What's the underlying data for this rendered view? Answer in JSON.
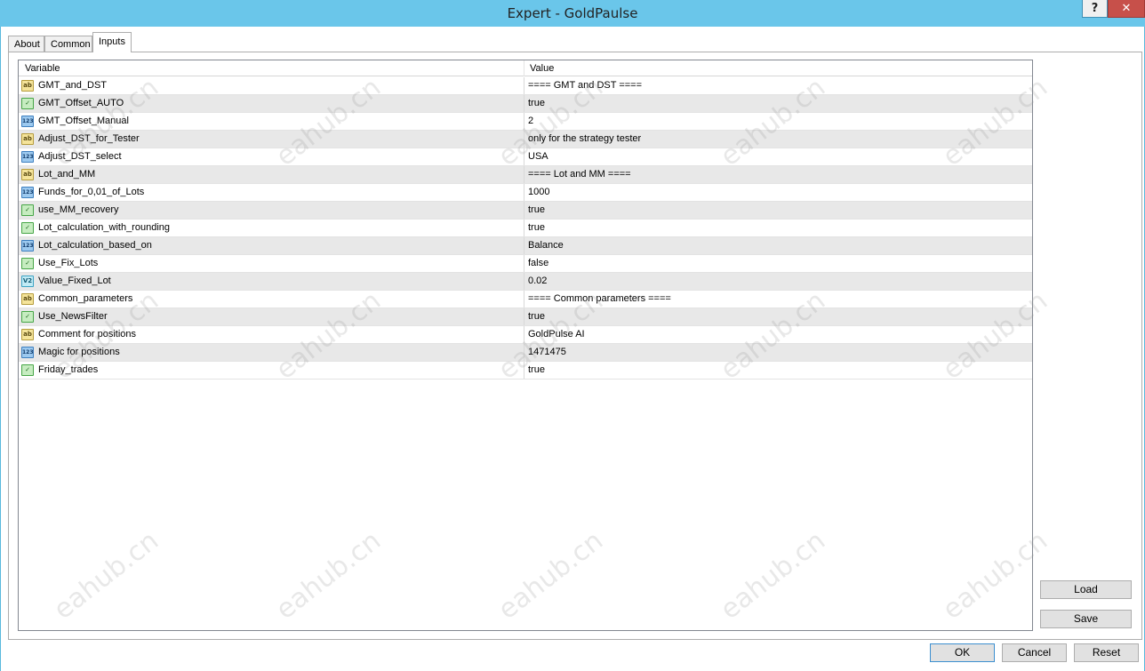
{
  "window": {
    "title": "Expert - GoldPaulse",
    "help_label": "?",
    "close_label": "✕"
  },
  "tabs": [
    {
      "label": "About"
    },
    {
      "label": "Common"
    },
    {
      "label": "Inputs"
    }
  ],
  "active_tab": "Inputs",
  "table": {
    "headers": {
      "variable": "Variable",
      "value": "Value"
    },
    "rows": [
      {
        "icon": "ab",
        "variable": "GMT_and_DST",
        "value": "==== GMT and DST ===="
      },
      {
        "icon": "bool",
        "variable": "GMT_Offset_AUTO",
        "value": "true"
      },
      {
        "icon": "123",
        "variable": "GMT_Offset_Manual",
        "value": "2"
      },
      {
        "icon": "ab",
        "variable": "Adjust_DST_for_Tester",
        "value": "only for the strategy tester"
      },
      {
        "icon": "123",
        "variable": "Adjust_DST_select",
        "value": "USA"
      },
      {
        "icon": "ab",
        "variable": "Lot_and_MM",
        "value": "==== Lot and MM ===="
      },
      {
        "icon": "123",
        "variable": "Funds_for_0,01_of_Lots",
        "value": "1000"
      },
      {
        "icon": "bool",
        "variable": "use_MM_recovery",
        "value": "true"
      },
      {
        "icon": "bool",
        "variable": "Lot_calculation_with_rounding",
        "value": "true"
      },
      {
        "icon": "123",
        "variable": "Lot_calculation_based_on",
        "value": "Balance"
      },
      {
        "icon": "bool",
        "variable": "Use_Fix_Lots",
        "value": "false"
      },
      {
        "icon": "dbl",
        "variable": "Value_Fixed_Lot",
        "value": "0.02"
      },
      {
        "icon": "ab",
        "variable": "Common_parameters",
        "value": "==== Common parameters ===="
      },
      {
        "icon": "bool",
        "variable": "Use_NewsFilter",
        "value": "true"
      },
      {
        "icon": "ab",
        "variable": "Comment for positions",
        "value": "GoldPulse AI"
      },
      {
        "icon": "123",
        "variable": "Magic for positions",
        "value": "1471475"
      },
      {
        "icon": "bool",
        "variable": "Friday_trades",
        "value": "true"
      }
    ]
  },
  "icon_labels": {
    "ab": "ab",
    "123": "123",
    "bool": "✓",
    "dbl": "V2"
  },
  "icon_names": {
    "ab": "string-type-icon",
    "123": "integer-type-icon",
    "bool": "boolean-type-icon",
    "dbl": "double-type-icon"
  },
  "buttons": {
    "load": "Load",
    "save": "Save",
    "ok": "OK",
    "cancel": "Cancel",
    "reset": "Reset"
  },
  "watermark": "eahub.cn"
}
